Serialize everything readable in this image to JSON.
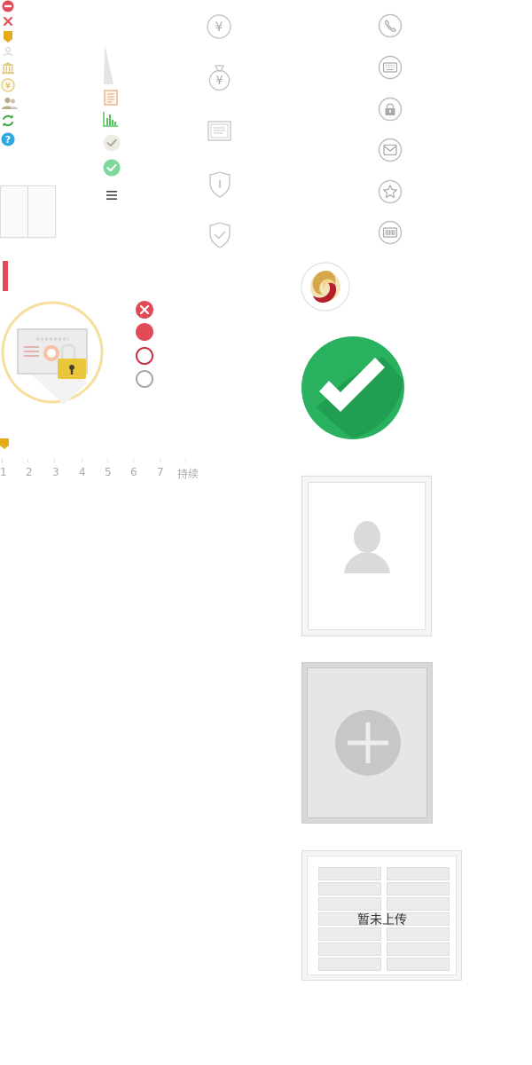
{
  "sprite": {
    "currency_symbol": "¥",
    "colors": {
      "red": "#e14b57",
      "gold": "#e5aa18",
      "gray_line": "#c8c8c8",
      "gray_text": "#a9a9a9",
      "green": "#2ab15f",
      "light_green": "#7fd89b",
      "blue": "#2ca8e4",
      "orange": "#e6a66e"
    },
    "small_icons": [
      {
        "name": "minus-circle-icon"
      },
      {
        "name": "close-x-icon"
      },
      {
        "name": "gold-tag-icon"
      },
      {
        "name": "user-outline-icon"
      },
      {
        "name": "bank-icon"
      },
      {
        "name": "yen-circle-icon"
      },
      {
        "name": "users-icon"
      },
      {
        "name": "refresh-icon"
      },
      {
        "name": "help-circle-icon"
      }
    ],
    "status_circles": [
      "close-circle-icon",
      "red-dot-icon",
      "red-ring-icon",
      "gray-ring-icon"
    ],
    "outline_icons_left": [
      "yen-circle-outline-icon",
      "money-bag-icon",
      "document-icon",
      "shield-info-icon",
      "shield-check-icon"
    ],
    "outline_icons_right": [
      "phone-icon",
      "keyboard-icon",
      "lock-icon",
      "mail-icon",
      "star-icon",
      "barcode-icon"
    ],
    "timeline": {
      "ticks": [
        "1",
        "2",
        "3",
        "4",
        "5",
        "6",
        "7",
        "持续"
      ]
    },
    "upload_empty_text": "暂未上传"
  }
}
